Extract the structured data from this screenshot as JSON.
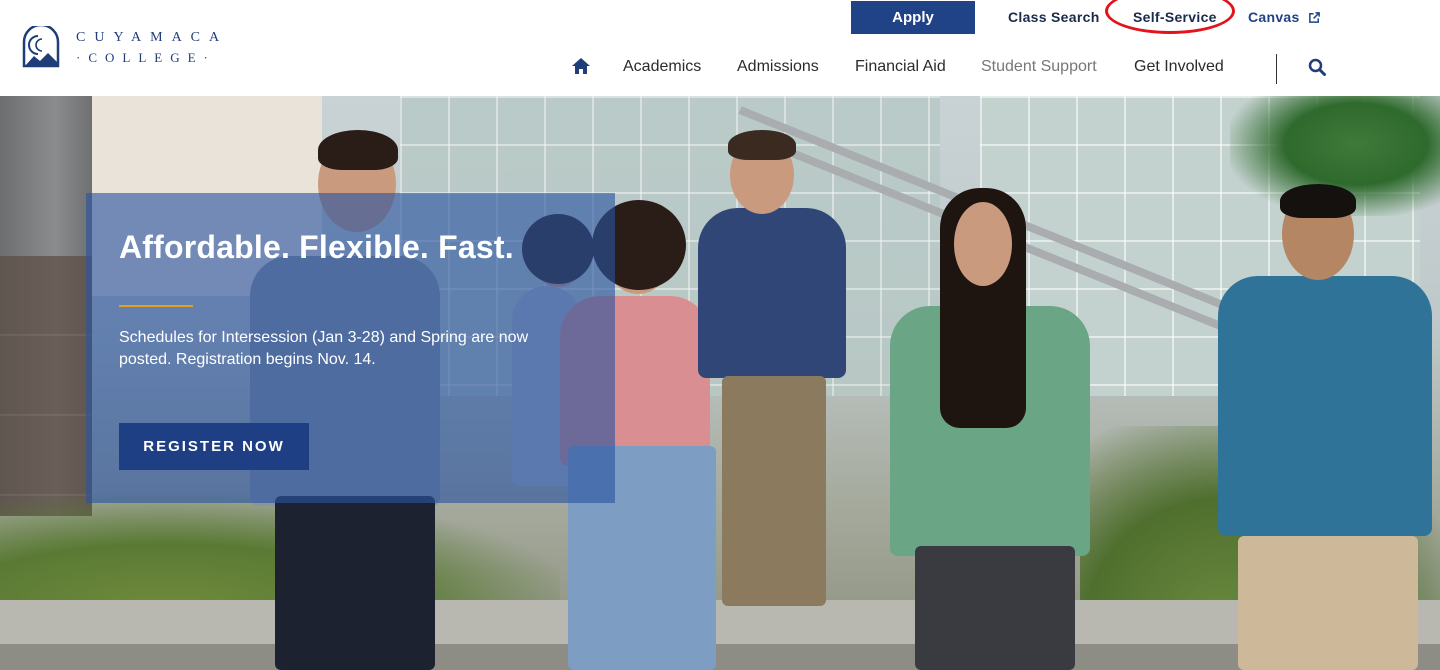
{
  "brand": {
    "line1": "CUYAMACA",
    "line2": "·COLLEGE·"
  },
  "utility": {
    "apply": "Apply",
    "class_search": "Class Search",
    "self_service": "Self-Service",
    "canvas": "Canvas"
  },
  "nav": {
    "items": [
      {
        "label": "Academics"
      },
      {
        "label": "Admissions"
      },
      {
        "label": "Financial Aid"
      },
      {
        "label": "Student Support"
      },
      {
        "label": "Get Involved"
      }
    ]
  },
  "icons": {
    "home": "home-icon",
    "search": "search-icon",
    "external": "external-link-icon"
  },
  "hero": {
    "title": "Affordable. Flexible. Fast.",
    "text": "Schedules for Intersession (Jan 3-28) and Spring are now posted. Registration begins Nov. 14.",
    "cta": "REGISTER NOW"
  },
  "colors": {
    "brand_blue": "#1f4386",
    "accent_gold": "#e0a321",
    "annotation_red": "#e3121b"
  }
}
